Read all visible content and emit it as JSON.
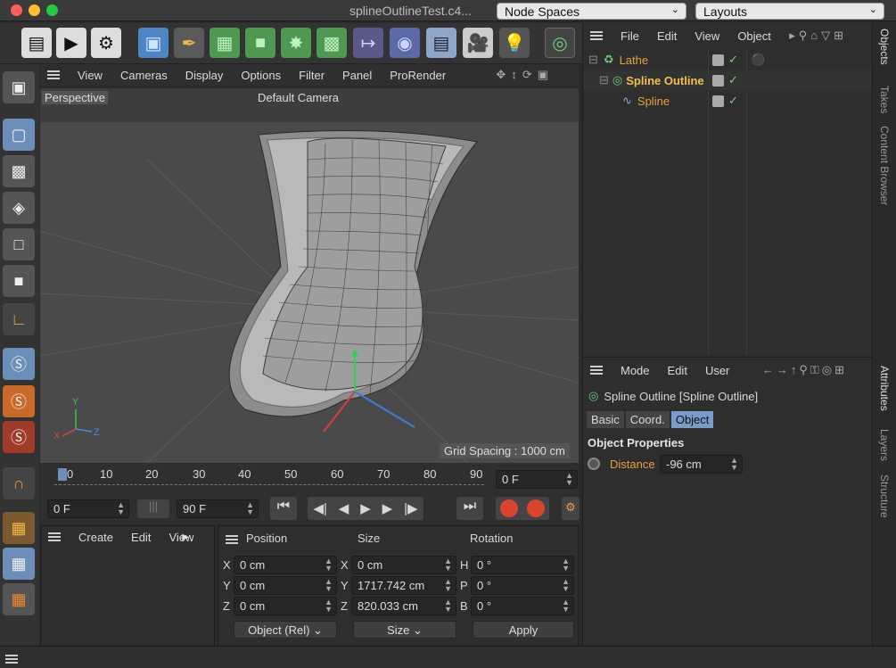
{
  "window": {
    "title": "splineOutlineTest.c4...",
    "node_spaces": "Node Spaces",
    "layouts": "Layouts"
  },
  "toolbar": {
    "icons": [
      "clapper-icon",
      "render-icon",
      "render-settings-icon",
      "cube-icon",
      "pen-icon",
      "subdivision-icon",
      "extrude-icon",
      "spline-array-icon",
      "array-icon",
      "symmetry-icon",
      "deformer-icon",
      "floor-icon",
      "camera-icon",
      "light-icon",
      "spline-outline-icon"
    ]
  },
  "viewport": {
    "menu": [
      "View",
      "Cameras",
      "Display",
      "Options",
      "Filter",
      "Panel",
      "ProRender"
    ],
    "label": "Perspective",
    "camera": "Default Camera",
    "grid": "Grid Spacing : 1000 cm",
    "axes": {
      "x": "X",
      "y": "Y",
      "z": "Z"
    }
  },
  "timeline": {
    "ticks": [
      "0",
      "10",
      "20",
      "30",
      "40",
      "50",
      "60",
      "70",
      "80",
      "90"
    ],
    "current": "0 F",
    "start": "0 F",
    "end": "90 F"
  },
  "objects": {
    "menu": [
      "File",
      "Edit",
      "View",
      "Object"
    ],
    "items": [
      {
        "name": "Lathe",
        "color": "#e8a23a"
      },
      {
        "name": "Spline Outline",
        "color": "#f0c24a"
      },
      {
        "name": "Spline",
        "color": "#e8a23a"
      }
    ]
  },
  "attributes": {
    "menu": [
      "Mode",
      "Edit",
      "User"
    ],
    "title": "Spline Outline [Spline Outline]",
    "tabs": [
      "Basic",
      "Coord.",
      "Object"
    ],
    "active_tab": "Object",
    "section": "Object Properties",
    "distance_label": "Distance",
    "distance_value": "-96 cm"
  },
  "side_tabs": {
    "top": [
      "Objects",
      "Takes",
      "Content Browser"
    ],
    "bottom": [
      "Attributes",
      "Layers",
      "Structure"
    ]
  },
  "materials": {
    "menu": [
      "Create",
      "Edit",
      "View"
    ]
  },
  "coords": {
    "headers": [
      "Position",
      "Size",
      "Rotation"
    ],
    "rows": [
      {
        "pl": "X",
        "pv": "0 cm",
        "sl": "X",
        "sv": "0 cm",
        "rl": "H",
        "rv": "0 °"
      },
      {
        "pl": "Y",
        "pv": "0 cm",
        "sl": "Y",
        "sv": "1717.742 cm",
        "rl": "P",
        "rv": "0 °"
      },
      {
        "pl": "Z",
        "pv": "0 cm",
        "sl": "Z",
        "sv": "820.033 cm",
        "rl": "B",
        "rv": "0 °"
      }
    ],
    "mode": "Object (Rel)",
    "size_mode": "Size",
    "apply": "Apply"
  }
}
